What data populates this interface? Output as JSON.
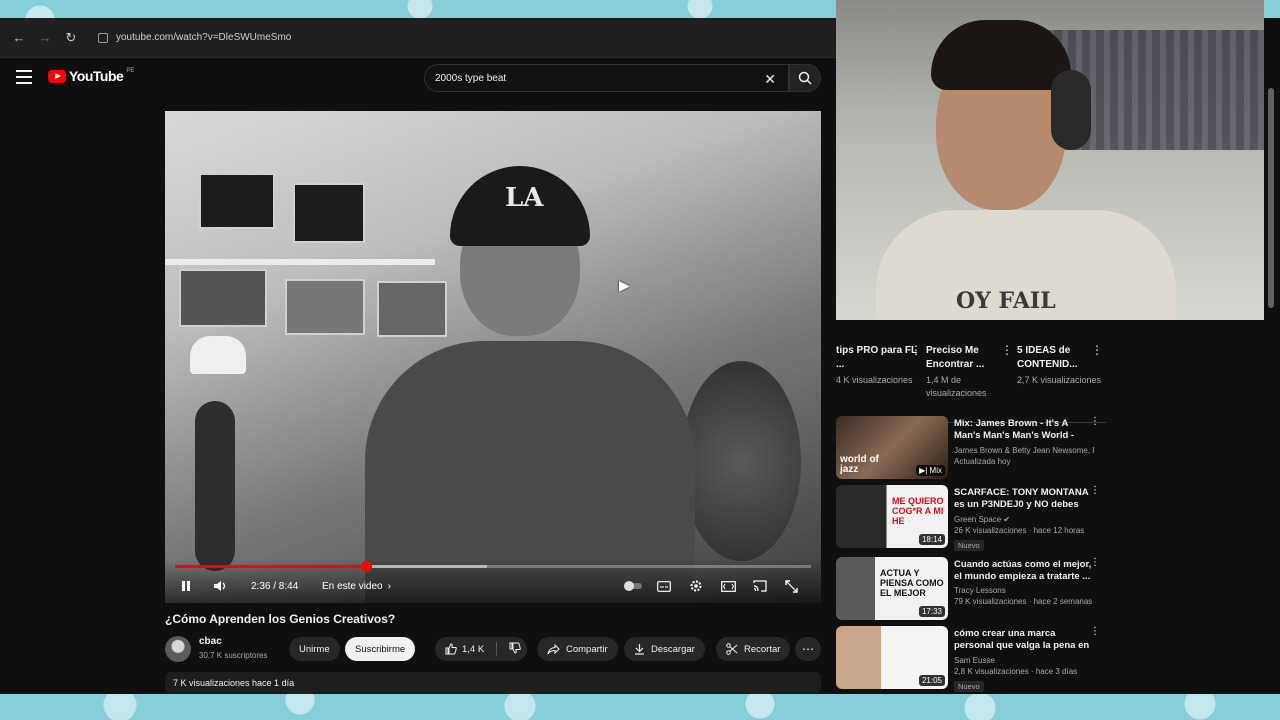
{
  "browser": {
    "url": "youtube.com/watch?v=DleSWUmeSmo"
  },
  "header": {
    "logo_text": "YouTube",
    "country_code": "PE",
    "search_value": "2000s type beat"
  },
  "player": {
    "time_display": "2:36 / 8:44",
    "chapters_label": "En este video",
    "progress": 0.3,
    "buffered": 0.49
  },
  "video": {
    "title": "¿Cómo Aprenden los Genios Creativos?",
    "channel_name": "cbac",
    "subscribers": "30,7 K suscriptores",
    "join_label": "Unirme",
    "subscribe_label": "Suscribirme",
    "likes": "1,4 K",
    "share_label": "Compartir",
    "download_label": "Descargar",
    "clip_label": "Recortar",
    "description_meta": "7 K visualizaciones  hace 1 día"
  },
  "webcam": {
    "shirt_text": "OY FAIL"
  },
  "sidebar": {
    "shorts": [
      {
        "title": "tips PRO para FL ...",
        "views": "4 K visualizaciones"
      },
      {
        "title": "Preciso Me Encontrar ...",
        "views": "1,4 M de visualizaciones"
      },
      {
        "title": "5 IDEAS de CONTENID...",
        "views": "2,7 K visualizaciones"
      }
    ],
    "recommendations": [
      {
        "title": "Mix: James Brown - It's A Man's Man's Man's World - Live - 11 ...",
        "channel": "James Brown & Betty Jean Newsome, R...",
        "meta": "Actualizada hoy",
        "badge": "",
        "duration": "Mix",
        "thumb_text": "world of jazz"
      },
      {
        "title": "SCARFACE: TONY MONTANA es un P3NDEJ0 y NO debes ser ...",
        "channel": "Green Space",
        "meta": "26 K visualizaciones · hace 12 horas",
        "badge": "Nuevo",
        "duration": "18:14",
        "thumb_text": "ME QUIERO COG*R A MI HE"
      },
      {
        "title": "Cuando actúas como el mejor, el mundo empieza a tratarte ...",
        "channel": "Tracy Lessons",
        "meta": "79 K visualizaciones · hace 2 semanas",
        "badge": "",
        "duration": "17:33",
        "thumb_text": "ACTUA Y PIENSA COMO EL MEJOR"
      },
      {
        "title": "cómo crear una marca personal que valga la pena en 2026",
        "channel": "Sam Eusse",
        "meta": "2,8 K visualizaciones · hace 3 días",
        "badge": "Nuevo",
        "duration": "21:05",
        "thumb_text": ""
      }
    ]
  },
  "colors": {
    "brand_red": "#ff0000",
    "background": "#0f0f0f"
  }
}
